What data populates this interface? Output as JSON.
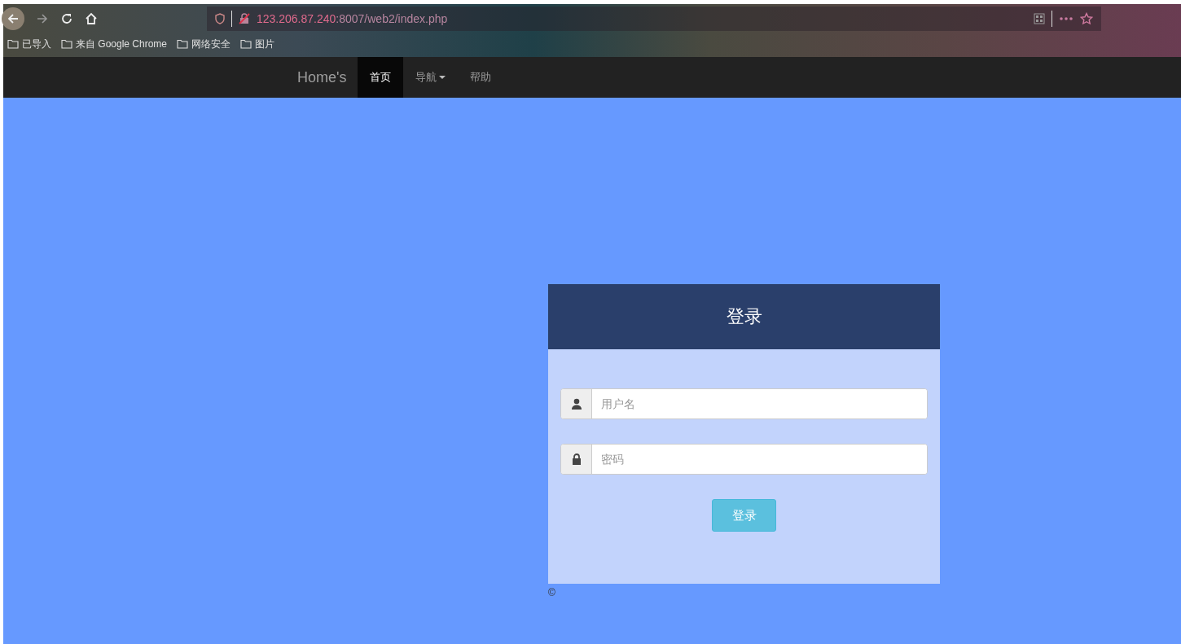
{
  "browser": {
    "url_host": "123.206.87.240",
    "url_path": ":8007/web2/index.php",
    "bookmarks": [
      "已导入",
      "来自 Google Chrome",
      "网络安全",
      "图片"
    ]
  },
  "navbar": {
    "brand": "Home's",
    "items": [
      {
        "label": "首页",
        "selected": true,
        "dropdown": false
      },
      {
        "label": "导航",
        "selected": false,
        "dropdown": true
      },
      {
        "label": "帮助",
        "selected": false,
        "dropdown": false
      }
    ]
  },
  "login": {
    "title": "登录",
    "fields": [
      {
        "kind": "user",
        "placeholder": "用户名"
      },
      {
        "kind": "password",
        "placeholder": "密码"
      }
    ],
    "button": "登录"
  },
  "footer": {
    "copyright": "©"
  }
}
